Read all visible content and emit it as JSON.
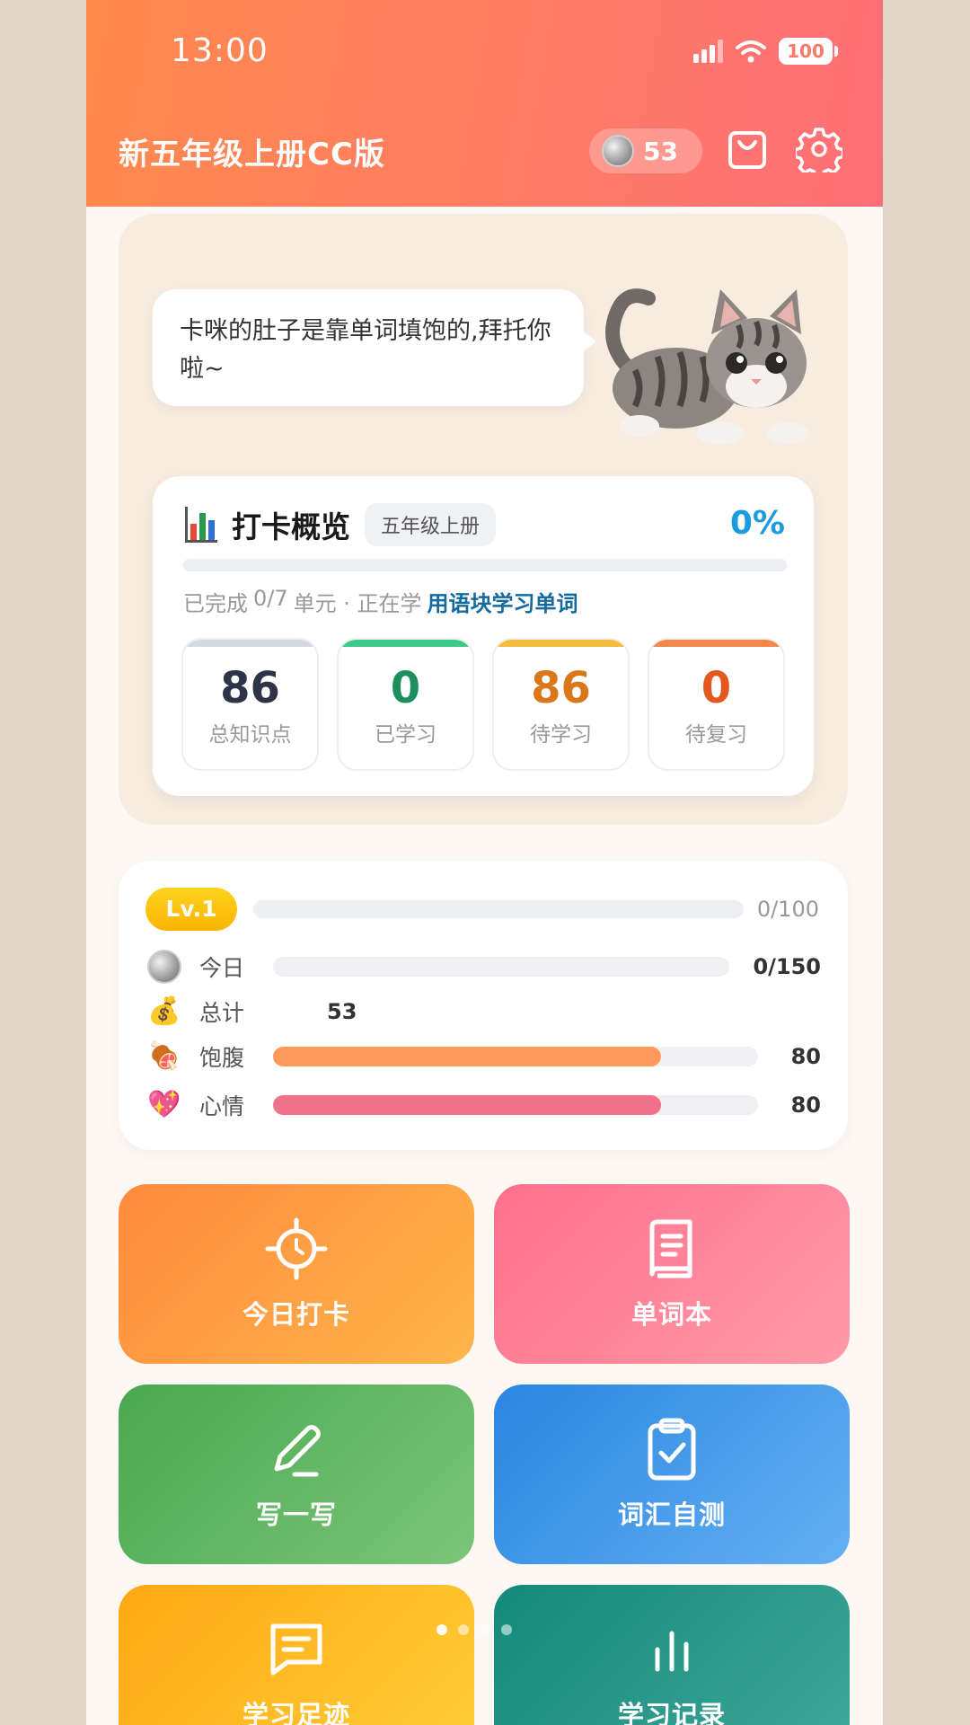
{
  "status_bar": {
    "time": "13:00",
    "battery": "100"
  },
  "header": {
    "title": "新五年级上册CC版",
    "coins": "53",
    "icons": [
      "coin-icon",
      "shopping-bag-icon",
      "gear-icon"
    ]
  },
  "pet": {
    "message": "卡咪的肚子是靠单词填饱的,拜托你啦~"
  },
  "overview": {
    "title": "打卡概览",
    "grade": "五年级上册",
    "percent": "0%",
    "progress": 0,
    "completed_label": "已完成",
    "completed": "0/7",
    "unit_label": "单元 · 正在学",
    "current": "用语块学习单词",
    "stats": [
      {
        "value": "86",
        "label": "总知识点",
        "color": "#2c3445",
        "bar": "#d4dae3"
      },
      {
        "value": "0",
        "label": "已学习",
        "color": "#1e8f5c",
        "bar": "#3ec98a"
      },
      {
        "value": "86",
        "label": "待学习",
        "color": "#d9771a",
        "bar": "#f3bd3c"
      },
      {
        "value": "0",
        "label": "待复习",
        "color": "#e2581e",
        "bar": "#f2874a"
      }
    ]
  },
  "level": {
    "badge": "Lv.1",
    "exp": "0/100",
    "exp_progress": 0,
    "rows": {
      "today": {
        "label": "今日",
        "value": "0/150",
        "progress": 0
      },
      "total": {
        "label": "总计",
        "value": "53"
      },
      "hunger": {
        "label": "饱腹",
        "value": "80",
        "progress": 0.8
      },
      "mood": {
        "label": "心情",
        "value": "80",
        "progress": 0.8
      }
    }
  },
  "tiles": [
    {
      "label": "今日打卡",
      "icon": "target-clock-icon"
    },
    {
      "label": "单词本",
      "icon": "book-icon"
    },
    {
      "label": "写一写",
      "icon": "pen-icon"
    },
    {
      "label": "词汇自测",
      "icon": "clipboard-check-icon"
    },
    {
      "label": "学习足迹",
      "icon": "message-icon"
    },
    {
      "label": "学习记录",
      "icon": "bar-chart-icon"
    }
  ],
  "pager": {
    "pages": 4,
    "current": 1
  }
}
